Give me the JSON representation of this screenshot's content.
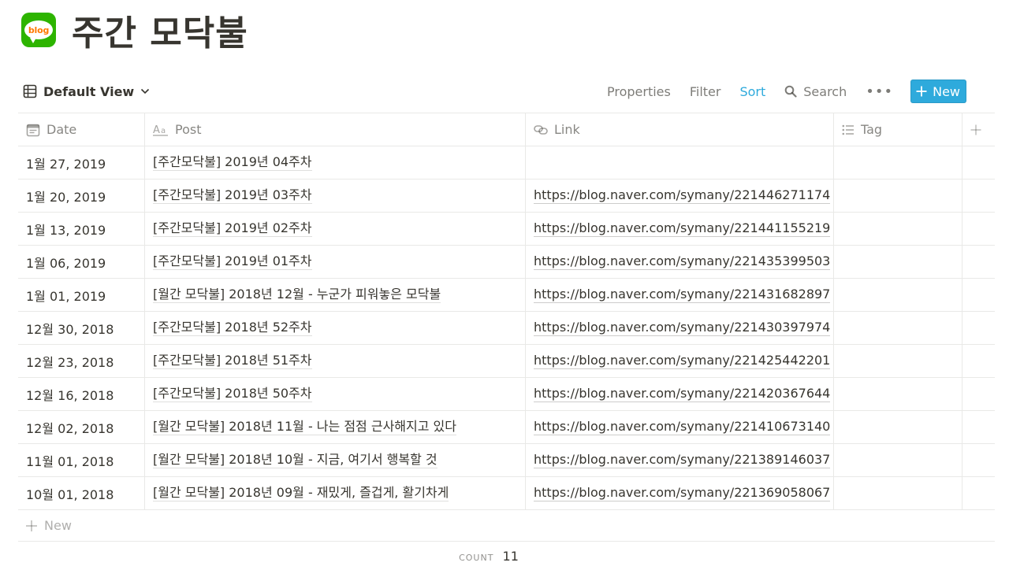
{
  "page": {
    "icon": "naver-blog-icon",
    "icon_text": "blog",
    "title": "주간 모닥불"
  },
  "toolbar": {
    "view_label": "Default View",
    "properties": "Properties",
    "filter": "Filter",
    "sort": "Sort",
    "search": "Search",
    "more": "•••",
    "new": "New"
  },
  "colors": {
    "accent": "#2eaadc",
    "icon_green": "#2db400",
    "icon_orange": "#ff7a00"
  },
  "table": {
    "columns": [
      {
        "label": "Date",
        "icon": "calendar-icon"
      },
      {
        "label": "Post",
        "icon": "text-aa-icon"
      },
      {
        "label": "Link",
        "icon": "link-icon"
      },
      {
        "label": "Tag",
        "icon": "list-icon"
      }
    ],
    "rows": [
      {
        "date": "1월 27, 2019",
        "post": "[주간모닥불] 2019년 04주차",
        "link": ""
      },
      {
        "date": "1월 20, 2019",
        "post": "[주간모닥불] 2019년 03주차",
        "link": "https://blog.naver.com/symany/221446271174"
      },
      {
        "date": "1월 13, 2019",
        "post": "[주간모닥불] 2019년 02주차",
        "link": "https://blog.naver.com/symany/221441155219"
      },
      {
        "date": "1월 06, 2019",
        "post": "[주간모닥불] 2019년 01주차",
        "link": "https://blog.naver.com/symany/221435399503"
      },
      {
        "date": "1월 01, 2019",
        "post": "[월간 모닥불] 2018년 12월 - 누군가 피워놓은 모닥불",
        "link": "https://blog.naver.com/symany/221431682897"
      },
      {
        "date": "12월 30, 2018",
        "post": "[주간모닥불] 2018년 52주차",
        "link": "https://blog.naver.com/symany/221430397974"
      },
      {
        "date": "12월 23, 2018",
        "post": "[주간모닥불] 2018년 51주차",
        "link": "https://blog.naver.com/symany/221425442201"
      },
      {
        "date": "12월 16, 2018",
        "post": "[주간모닥불] 2018년 50주차",
        "link": "https://blog.naver.com/symany/221420367644"
      },
      {
        "date": "12월 02, 2018",
        "post": "[월간 모닥불] 2018년 11월 - 나는 점점 근사해지고 있다",
        "link": "https://blog.naver.com/symany/221410673140"
      },
      {
        "date": "11월 01, 2018",
        "post": "[월간 모닥불] 2018년 10월 - 지금, 여기서 행복할 것",
        "link": "https://blog.naver.com/symany/221389146037"
      },
      {
        "date": "10월 01, 2018",
        "post": "[월간 모닥불] 2018년 09월 - 재밌게, 즐겁게, 활기차게",
        "link": "https://blog.naver.com/symany/221369058067"
      }
    ],
    "new_row_label": "New"
  },
  "footer": {
    "count_label": "COUNT",
    "count_value": "11"
  }
}
